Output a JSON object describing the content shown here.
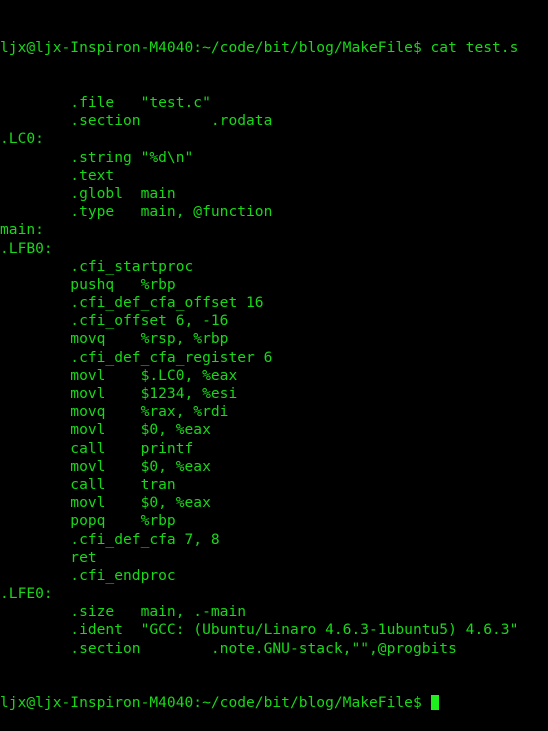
{
  "terminal": {
    "colors": {
      "background": "#000000",
      "foreground": "#18d818",
      "cursor": "#1ef01e"
    },
    "prompt": "ljx@ljx-Inspiron-M4040:~/code/bit/blog/MakeFile$",
    "command": "cat test.s",
    "command_line": "ljx@ljx-Inspiron-M4040:~/code/bit/blog/MakeFile$ cat test.s",
    "final_prompt": "ljx@ljx-Inspiron-M4040:~/code/bit/blog/MakeFile$ ",
    "output_lines": [
      "        .file   \"test.c\"",
      "        .section        .rodata",
      ".LC0:",
      "        .string \"%d\\n\"",
      "        .text",
      "        .globl  main",
      "        .type   main, @function",
      "main:",
      ".LFB0:",
      "        .cfi_startproc",
      "        pushq   %rbp",
      "        .cfi_def_cfa_offset 16",
      "        .cfi_offset 6, -16",
      "        movq    %rsp, %rbp",
      "        .cfi_def_cfa_register 6",
      "        movl    $.LC0, %eax",
      "        movl    $1234, %esi",
      "        movq    %rax, %rdi",
      "        movl    $0, %eax",
      "        call    printf",
      "        movl    $0, %eax",
      "        call    tran",
      "        movl    $0, %eax",
      "        popq    %rbp",
      "        .cfi_def_cfa 7, 8",
      "        ret",
      "        .cfi_endproc",
      ".LFE0:",
      "        .size   main, .-main",
      "        .ident  \"GCC: (Ubuntu/Linaro 4.6.3-1ubuntu5) 4.6.3\"",
      "        .section        .note.GNU-stack,\"\",@progbits"
    ]
  }
}
